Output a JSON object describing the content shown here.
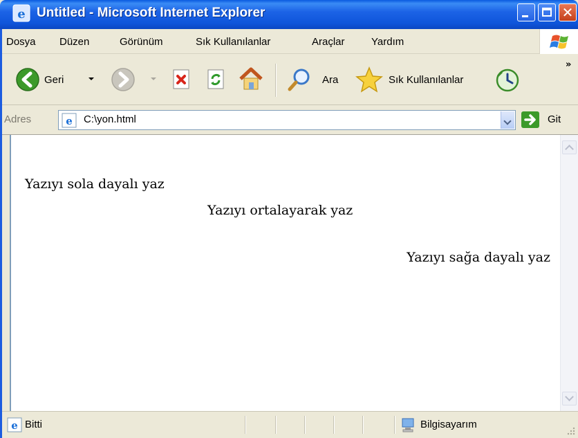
{
  "window": {
    "title": "Untitled - Microsoft Internet Explorer"
  },
  "menubar": {
    "items": [
      "Dosya",
      "Düzen",
      "Görünüm",
      "Sık Kullanılanlar",
      "Araçlar",
      "Yardım"
    ]
  },
  "toolbar": {
    "back_label": "Geri",
    "search_label": "Ara",
    "favorites_label": "Sık Kullanılanlar",
    "more_label": "»"
  },
  "addressbar": {
    "label": "Adres",
    "value": "C:\\yon.html",
    "go_label": "Git"
  },
  "content": {
    "para_left": "Yazıyı sola dayalı yaz",
    "para_center": "Yazıyı ortalayarak yaz",
    "para_right": "Yazıyı sağa dayalı yaz"
  },
  "statusbar": {
    "status": "Bitti",
    "zone": "Bilgisayarım"
  },
  "colors": {
    "titlebar": "#1c63e6",
    "chrome": "#ece9d8",
    "close_button": "#c5411b"
  }
}
